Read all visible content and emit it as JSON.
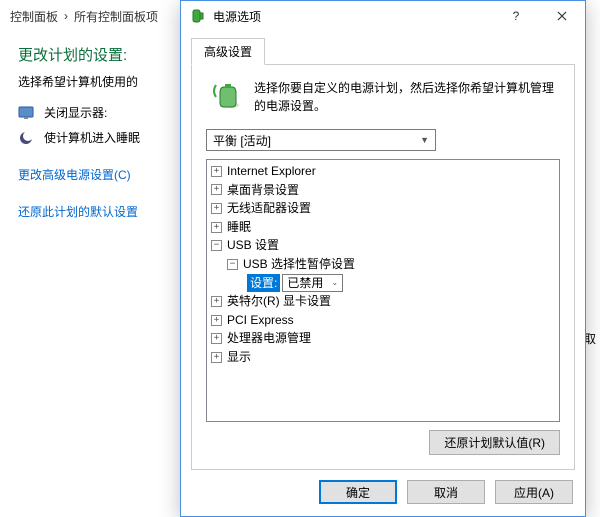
{
  "bg": {
    "breadcrumb": {
      "a": "控制面板",
      "b": "所有控制面板项"
    },
    "title": "更改计划的设置:",
    "desc": "选择希望计算机使用的",
    "monitor_label": "关闭显示器:",
    "sleep_label": "使计算机进入睡眠",
    "link_adv": "更改高级电源设置(C)",
    "link_restore": "还原此计划的默认设置",
    "right_cancel": "取"
  },
  "dialog": {
    "title": "电源选项",
    "tab": "高级设置",
    "intro": "选择你要自定义的电源计划，然后选择你希望计算机管理的电源设置。",
    "plan": "平衡 [活动]",
    "tree": {
      "ie": "Internet Explorer",
      "desktop": "桌面背景设置",
      "wireless": "无线适配器设置",
      "sleep": "睡眠",
      "usb": "USB 设置",
      "usb_sel": "USB 选择性暂停设置",
      "setting_label": "设置:",
      "setting_value": "已禁用",
      "intel_gpu": "英特尔(R) 显卡设置",
      "pci": "PCI Express",
      "cpu": "处理器电源管理",
      "display": "显示"
    },
    "restore_btn": "还原计划默认值(R)",
    "ok": "确定",
    "cancel": "取消",
    "apply": "应用(A)"
  }
}
